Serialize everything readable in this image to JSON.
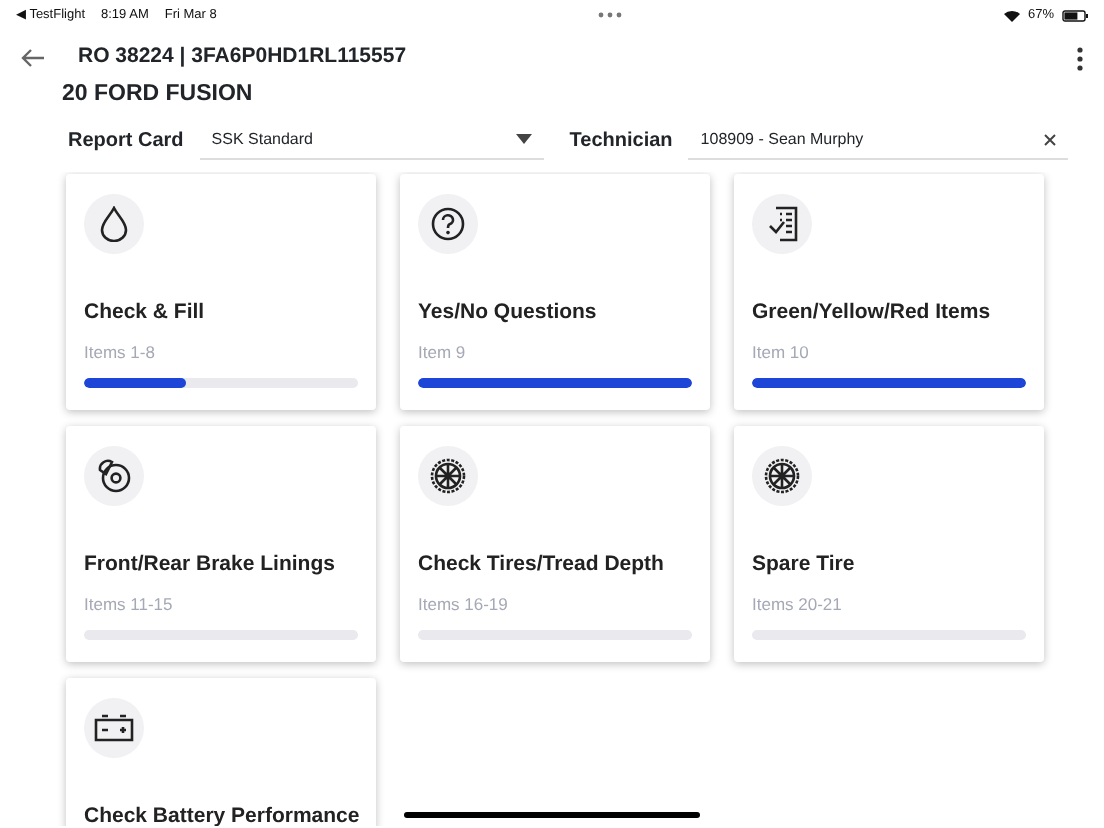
{
  "status_bar": {
    "back_app": "◀ TestFlight",
    "time": "8:19 AM",
    "date": "Fri Mar 8",
    "battery": "67%"
  },
  "header": {
    "title": "RO 38224 | 3FA6P0HD1RL115557",
    "subtitle": "20 FORD FUSION"
  },
  "report_card": {
    "label": "Report Card",
    "value": "SSK Standard"
  },
  "technician": {
    "label": "Technician",
    "value": "108909 - Sean Murphy"
  },
  "cards": [
    {
      "title": "Check & Fill",
      "items": "Items 1-8",
      "level": 0.37
    },
    {
      "title": "Yes/No Questions",
      "items": "Item 9",
      "level": 1
    },
    {
      "title": "Green/Yellow/Red Items",
      "items": "Item 10",
      "level": 1
    },
    {
      "title": "Front/Rear Brake Linings",
      "items": "Items 11-15",
      "level": 0
    },
    {
      "title": "Check Tires/Tread Depth",
      "items": "Items 16-19",
      "level": 0
    },
    {
      "title": "Spare Tire",
      "items": "Items 20-21",
      "level": 0
    },
    {
      "title": "Check Battery Performance"
    }
  ]
}
